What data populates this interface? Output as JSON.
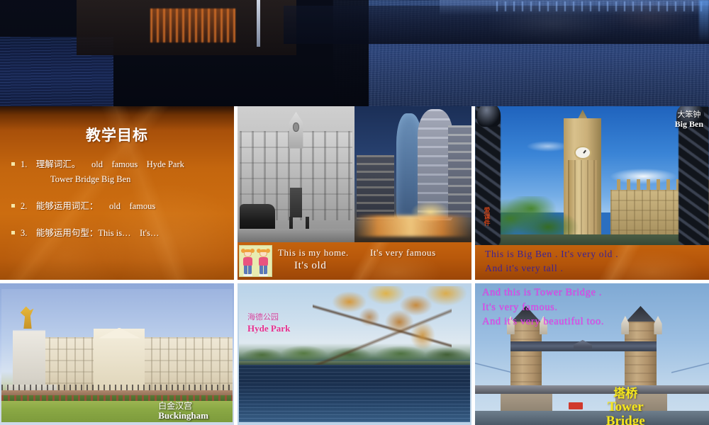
{
  "banner": {
    "name": "night-river-banner",
    "description": "Dark night view of a river with a lit boat on the left and rippling blue water on the right"
  },
  "slides": [
    {
      "id": "teaching-objectives",
      "title": "教学目标",
      "bullets": [
        {
          "num": "1.",
          "text": "理解词汇。",
          "words": [
            "old",
            "famous",
            "Hyde",
            "Park"
          ],
          "line1": "1. 理解词汇。  old famous Hyde Park",
          "line2": "Tower  Bridge   Big  Ben"
        },
        {
          "num": "2.",
          "text": "能够运用词汇：",
          "words": [
            "old",
            "famous"
          ],
          "line1": "2. 能够运用词汇：  old famous"
        },
        {
          "num": "3.",
          "text": "能够运用句型：",
          "words": [
            "This  is…",
            "It's…"
          ],
          "line1": "3. 能够运用句型：This  is… It's…"
        }
      ]
    },
    {
      "id": "my-home",
      "photo_left": "old-black-and-white-building",
      "photo_right": "modern-dancing-house-at-night",
      "icon": "two-cartoon-girls-icon",
      "caption_a": "This  is  my  home.",
      "caption_b": "It's  very  famous",
      "caption_c": "It's  old"
    },
    {
      "id": "big-ben",
      "photo": "big-ben-clock-tower-through-iron-railings",
      "label_cn": "大笨钟",
      "label_en": "Big Ben",
      "watermark": "爱课件",
      "caption_line1": "This  is  Big  Ben .  It's  very  old .",
      "caption_line2": "And  it's  very  tall .",
      "caption_color": "#3b2196"
    },
    {
      "id": "buckingham",
      "photo": "buckingham-palace-with-victoria-memorial",
      "label_cn": "白金汉宫",
      "label_en": "Buckingham"
    },
    {
      "id": "hyde-park",
      "photo": "hyde-park-lake-with-autumn-branch",
      "label_cn": "海德公园",
      "label_en": "Hyde Park",
      "label_color": "#e52e8e"
    },
    {
      "id": "tower-bridge",
      "photo": "tower-bridge-over-the-thames",
      "caption_line1": "And  this  is  Tower  Bridge .",
      "caption_line2": "It's  very  famous.",
      "caption_line3": "And  it's  very  beautiful  too.",
      "caption_color": "#ec3df0",
      "label_cn": "塔桥",
      "label_en": "Tower",
      "label_en2": "Bridge",
      "label_color": "#f6e71c"
    }
  ]
}
